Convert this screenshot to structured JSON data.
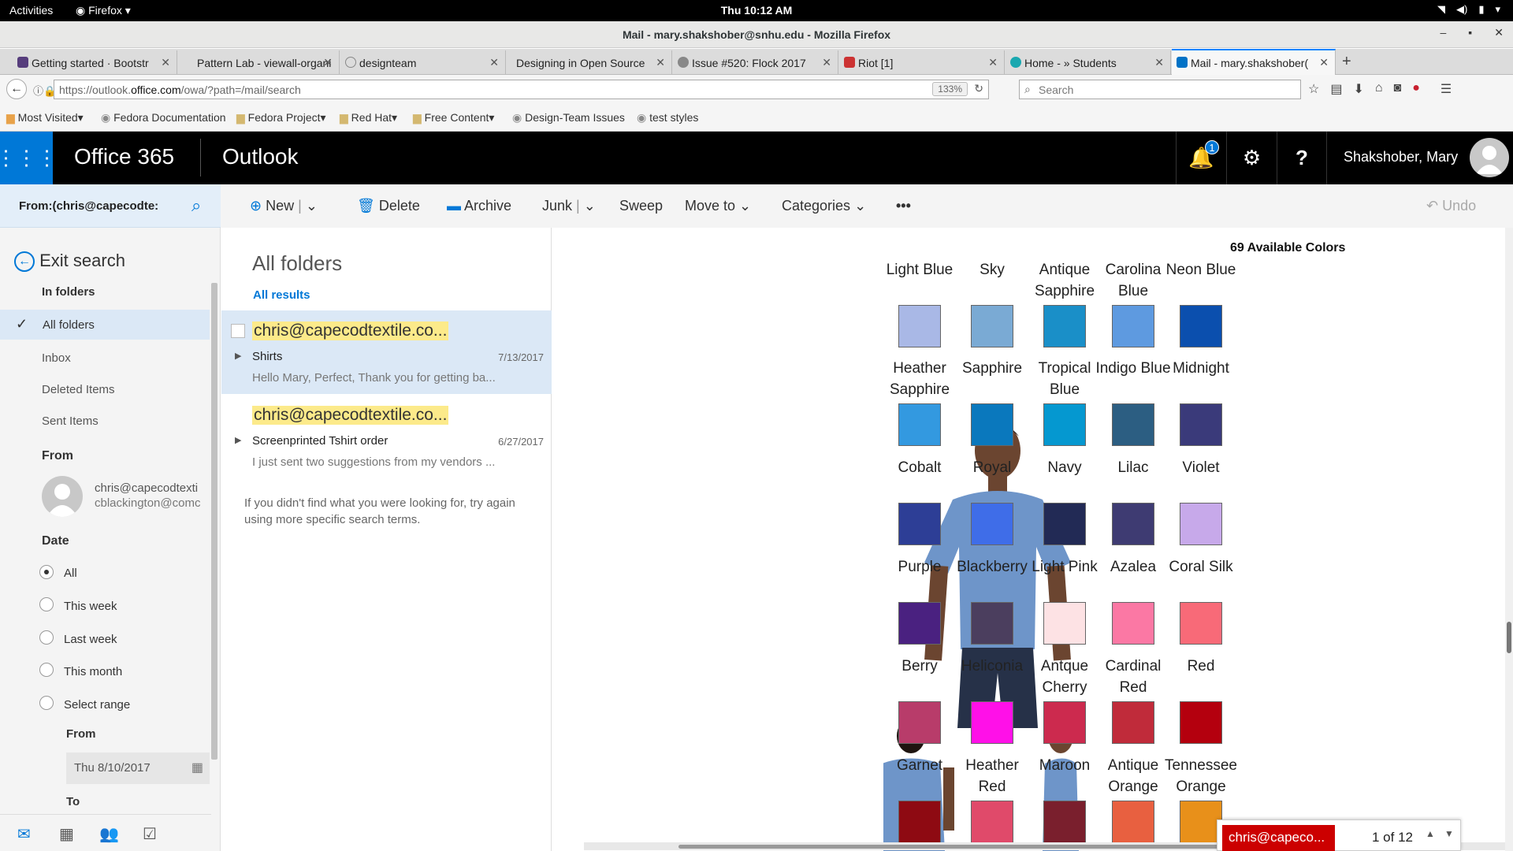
{
  "gnome": {
    "activities": "Activities",
    "app": "Firefox",
    "clock": "Thu 10:12 AM"
  },
  "window": {
    "title": "Mail - mary.shakshober@snhu.edu - Mozilla Firefox"
  },
  "tabs": [
    {
      "label": "Getting started · Bootstr",
      "color": "#563d7c"
    },
    {
      "label": "Pattern Lab - viewall-organi",
      "color": "#999999"
    },
    {
      "label": "designteam",
      "color": "#f5f5f5"
    },
    {
      "label": "Designing in Open Source",
      "color": "#f5f5f5"
    },
    {
      "label": "Issue #520: Flock 2017",
      "color": "#888888"
    },
    {
      "label": "Riot [1]",
      "color": "#cc3333"
    },
    {
      "label": "Home - » Students",
      "color": "#1aa8b0"
    },
    {
      "label": "Mail - mary.shakshober(",
      "color": "#0072c6"
    }
  ],
  "nav": {
    "url_prefix": "https://outlook.",
    "url_domain": "office.com",
    "url_suffix": "/owa/?path=/mail/search",
    "zoom": "133%",
    "search_placeholder": "Search"
  },
  "bookmarks": [
    "Most Visited",
    "Fedora Documentation",
    "Fedora Project",
    "Red Hat",
    "Free Content",
    "Design-Team Issues",
    "test styles"
  ],
  "o365": {
    "brand": "Office 365",
    "app": "Outlook",
    "notif_count": "1",
    "user": "Shakshober, Mary"
  },
  "search": {
    "query": "From:(chris@capecodte:"
  },
  "commands": {
    "new": "New",
    "delete": "Delete",
    "archive": "Archive",
    "junk": "Junk",
    "sweep": "Sweep",
    "move_to": "Move to",
    "categories": "Categories",
    "more": "•••",
    "undo": "Undo"
  },
  "leftpane": {
    "exit_search": "Exit search",
    "in_folders": "In folders",
    "folders": [
      "All folders",
      "Inbox",
      "Deleted Items",
      "Sent Items"
    ],
    "from_heading": "From",
    "from_line1": "chris@capecodtexti",
    "from_line2": "cblackington@comc",
    "date_heading": "Date",
    "date_options": [
      "All",
      "This week",
      "Last week",
      "This month",
      "Select range"
    ],
    "from_label": "From",
    "from_date": "Thu 8/10/2017",
    "to_label": "To"
  },
  "msglist": {
    "title": "All folders",
    "results_link": "All results",
    "messages": [
      {
        "from": "chris@capecodtextile.co...",
        "subject": "Shirts",
        "date": "7/13/2017",
        "preview": "Hello Mary, Perfect, Thank you for getting ba..."
      },
      {
        "from": "chris@capecodtextile.co...",
        "subject": "Screenprinted Tshirt order",
        "date": "6/27/2017",
        "preview": "I just sent two suggestions from my vendors ..."
      }
    ],
    "hint": "If you didn't find what you were looking for, try again using more specific search terms."
  },
  "reading": {
    "colors_title": "69 Available Colors",
    "rows": [
      [
        {
          "name": "Light Blue",
          "color": "#a9b8e6"
        },
        {
          "name": "Sky",
          "color": "#7aaad4"
        },
        {
          "name": "Antique Sapphire",
          "color": "#1a8fc8"
        },
        {
          "name": "Carolina Blue",
          "color": "#5e9ae0"
        },
        {
          "name": "Neon Blue",
          "color": "#0b4fae"
        }
      ],
      [
        {
          "name": "Heather Sapphire",
          "color": "#3399e0"
        },
        {
          "name": "Sapphire",
          "color": "#0a78bd"
        },
        {
          "name": "Tropical Blue",
          "color": "#0598d0"
        },
        {
          "name": "Indigo Blue",
          "color": "#2c5e82"
        },
        {
          "name": "Midnight",
          "color": "#3a3a7a"
        }
      ],
      [
        {
          "name": "Cobalt",
          "color": "#2d3e96"
        },
        {
          "name": "Royal",
          "color": "#3f6de8"
        },
        {
          "name": "Navy",
          "color": "#222a55"
        },
        {
          "name": "Lilac",
          "color": "#3e3b72"
        },
        {
          "name": "Violet",
          "color": "#c7a9ea"
        }
      ],
      [
        {
          "name": "Purple",
          "color": "#4a2180"
        },
        {
          "name": "Blackberry",
          "color": "#4b3e5e"
        },
        {
          "name": "Light Pink",
          "color": "#fde2e4"
        },
        {
          "name": "Azalea",
          "color": "#fb78a4"
        },
        {
          "name": "Coral Silk",
          "color": "#f86a78"
        }
      ],
      [
        {
          "name": "Berry",
          "color": "#b83c6a"
        },
        {
          "name": "Heliconia",
          "color": "#ff10e8"
        },
        {
          "name": "Antque Cherry",
          "color": "#cc2a4e"
        },
        {
          "name": "Cardinal Red",
          "color": "#c02b3a"
        },
        {
          "name": "Red",
          "color": "#b4000e"
        }
      ],
      [
        {
          "name": "Garnet",
          "color": "#8e0a12"
        },
        {
          "name": "Heather Red",
          "color": "#e04a6a"
        },
        {
          "name": "Maroon",
          "color": "#7a1f2d"
        },
        {
          "name": "Antique Orange",
          "color": "#e86040"
        },
        {
          "name": "Tennessee Orange",
          "color": "#e8901a"
        }
      ]
    ]
  },
  "notification": {
    "sender": "chris@capeco...",
    "count": "1 of 12"
  }
}
